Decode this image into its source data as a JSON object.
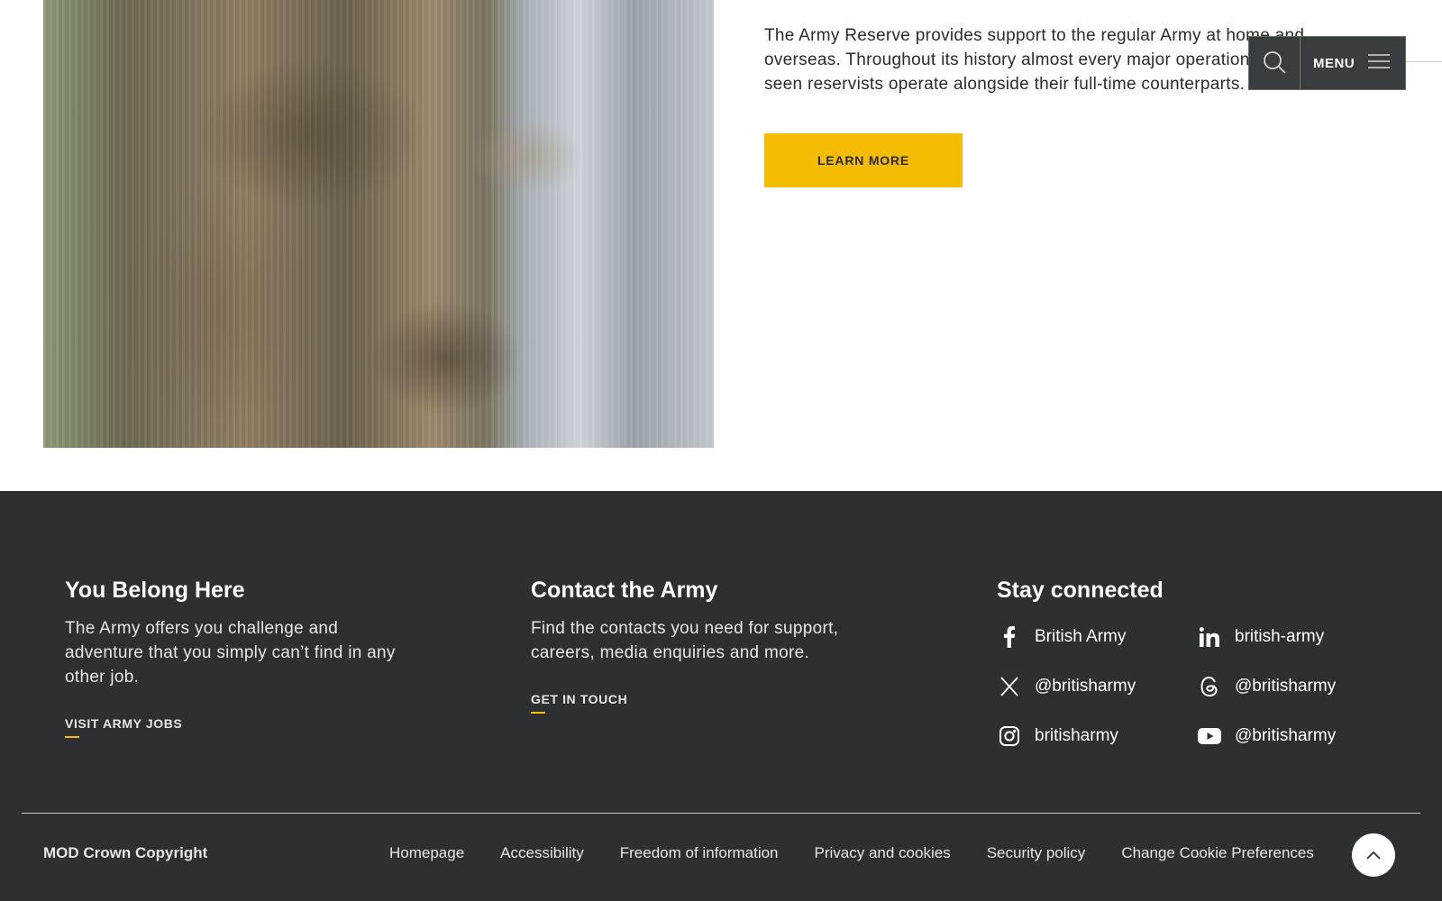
{
  "hero": {
    "image_alt": "Army reservists in camouflage uniform kneeling beside a fence"
  },
  "intro": {
    "text": "The Army Reserve provides support to the regular Army at home and overseas. Throughout its history almost every major operation has seen reservists operate alongside their full-time counterparts.",
    "button_label": "LEARN MORE"
  },
  "header": {
    "search_icon": "search-icon",
    "menu_label": "MENU",
    "menu_icon": "hamburger-icon"
  },
  "footer": {
    "columns": [
      {
        "title": "You Belong Here",
        "text": "The Army offers you challenge and adventure that you simply can’t find in any other job.",
        "link": "VISIT ARMY JOBS"
      },
      {
        "title": "Contact the Army",
        "text": "Find the contacts you need for support, careers, media enquiries and more.",
        "link": "GET IN TOUCH"
      }
    ],
    "social": {
      "title": "Stay connected",
      "items": [
        {
          "icon": "facebook-icon",
          "label": "British Army"
        },
        {
          "icon": "linkedin-icon",
          "label": "british-army"
        },
        {
          "icon": "x-icon",
          "label": "@britisharmy"
        },
        {
          "icon": "threads-icon",
          "label": "@britisharmy"
        },
        {
          "icon": "instagram-icon",
          "label": "britisharmy"
        },
        {
          "icon": "youtube-icon",
          "label": "@britisharmy"
        }
      ]
    },
    "copyright": "MOD Crown Copyright",
    "nav": [
      "Homepage",
      "Accessibility",
      "Freedom of information",
      "Privacy and cookies",
      "Security policy",
      "Change Cookie Preferences"
    ],
    "back_to_top_icon": "chevron-up-icon"
  },
  "colors": {
    "accent_yellow": "#f4bd03",
    "footer_bg": "#2e2f31",
    "header_bg": "#3a3d3f"
  }
}
